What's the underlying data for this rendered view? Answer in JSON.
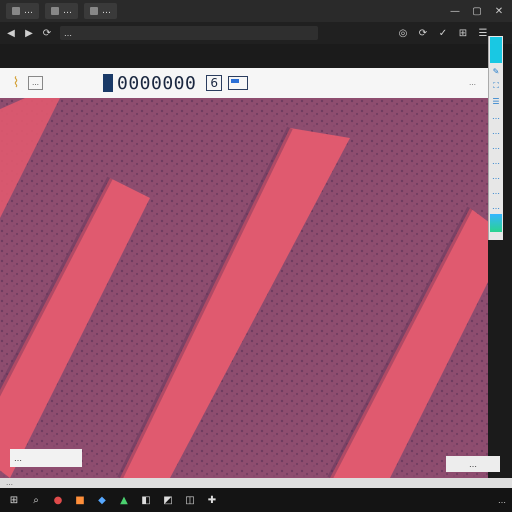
{
  "browser": {
    "tabs": [
      {
        "label": "…",
        "icon": "tab-icon"
      },
      {
        "label": "…",
        "icon": "tab-icon"
      },
      {
        "label": "…",
        "icon": "tab-icon"
      }
    ],
    "controls": {
      "minimize": "—",
      "maximize": "▢",
      "close": "✕"
    },
    "address": {
      "url": "…"
    },
    "extensions": [
      "◎",
      "⟳",
      "✓",
      "⊞",
      "☰"
    ]
  },
  "viewer": {
    "toolbar": {
      "logo_icon": "pin-icon",
      "badge_text": "…",
      "counter": "0000000",
      "scale_text": "6",
      "right_text": "…"
    },
    "sidepanel": {
      "buttons": [
        "✎",
        "⛶",
        "☰",
        "…",
        "…",
        "…",
        "…",
        "…",
        "…",
        "…"
      ],
      "accent_top": "#19c8e3",
      "accent_bottom": "#2ad38f"
    },
    "labels": {
      "left": "…",
      "right": "…"
    },
    "colors": {
      "stroma": "#e05a6f",
      "tissue": "#8e4d6f",
      "tissue_dark": "#5a2f55"
    }
  },
  "statusbar": {
    "text": "…"
  },
  "taskbar": {
    "items": [
      "⊞",
      "⌕",
      "●",
      "■",
      "◆",
      "▲",
      "◧",
      "◩",
      "◫",
      "✚"
    ],
    "tray_text": "…"
  }
}
